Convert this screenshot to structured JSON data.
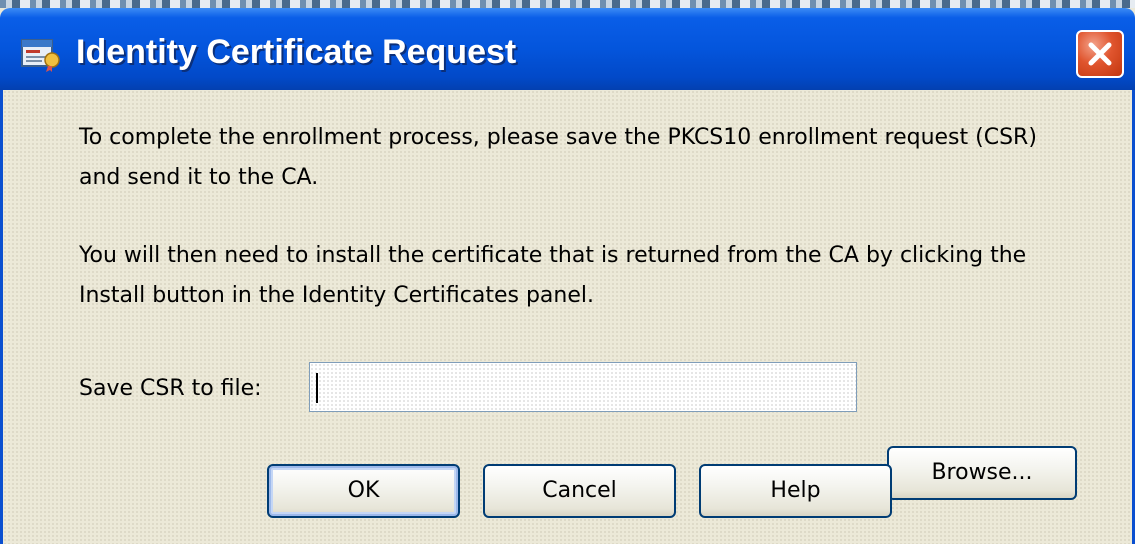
{
  "window": {
    "title": "Identity Certificate Request"
  },
  "message": {
    "paragraph_1": "To complete the enrollment process, please save the PKCS10 enrollment request (CSR) and send it to the CA.",
    "paragraph_2": "You will then need to install the certificate that is returned from the CA by clicking the Install button in the Identity Certificates panel."
  },
  "save_csr": {
    "label": "Save CSR to file:",
    "value": "",
    "browse_label": "Browse..."
  },
  "buttons": {
    "ok": "OK",
    "cancel": "Cancel",
    "help": "Help"
  },
  "icons": {
    "app": "certificate-window-icon",
    "close": "close-icon"
  },
  "colors": {
    "titlebar": "#0455dc",
    "window_background": "#ece9d8",
    "close_button": "#e0552e",
    "button_border": "#003c74"
  }
}
